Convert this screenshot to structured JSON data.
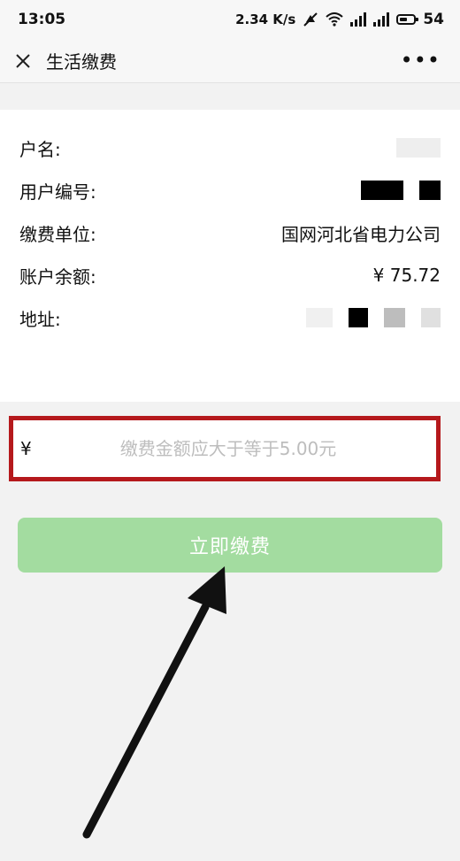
{
  "status_bar": {
    "time": "13:05",
    "net_speed": "2.34 K/s",
    "battery": "54",
    "icons": [
      "mute-icon",
      "wifi-icon",
      "signal-4g-icon",
      "signal-icon",
      "battery-icon"
    ]
  },
  "title_bar": {
    "title": "生活缴费",
    "close_icon": "close-icon",
    "more_icon": "more-icon"
  },
  "account": {
    "rows": [
      {
        "label": "户名:",
        "value": ""
      },
      {
        "label": "用户编号:",
        "value": ""
      },
      {
        "label": "缴费单位:",
        "value": "国网河北省电力公司"
      },
      {
        "label": "账户余额:",
        "value": "¥ 75.72"
      },
      {
        "label": "地址:",
        "value": ""
      }
    ]
  },
  "amount": {
    "currency": "¥",
    "placeholder": "缴费金额应大于等于5.00元",
    "value": ""
  },
  "pay_button": {
    "label": "立即缴费"
  },
  "colors": {
    "highlight_border": "#b5191c",
    "pay_button_bg": "#a3dca0",
    "page_bg": "#f2f2f2"
  }
}
